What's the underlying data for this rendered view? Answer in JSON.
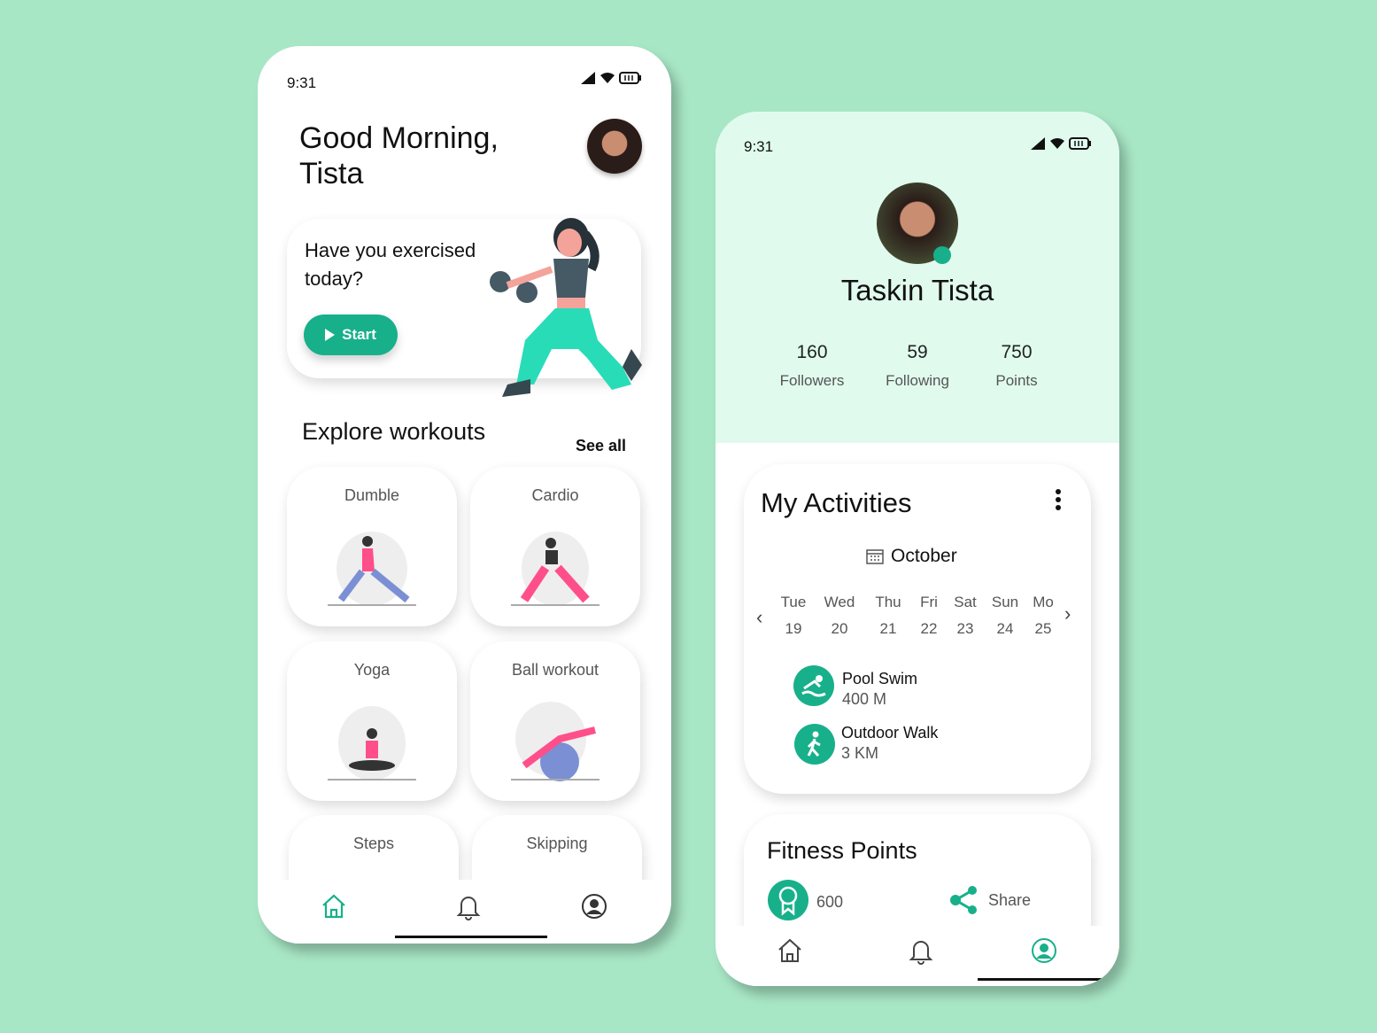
{
  "colors": {
    "background": "#a8e7c6",
    "accent": "#17b08a",
    "profile_header": "#e0fbee"
  },
  "home": {
    "status_time": "9:31",
    "greeting": "Good Morning,",
    "user_name": "Tista",
    "promo": {
      "text_line1": "Have you exercised",
      "text_line2": "today?",
      "start_label": "Start",
      "start_icon": "play-icon"
    },
    "section_title": "Explore workouts",
    "see_all": "See all",
    "workouts": [
      {
        "label": "Dumble"
      },
      {
        "label": "Cardio"
      },
      {
        "label": "Yoga"
      },
      {
        "label": "Ball workout"
      },
      {
        "label": "Steps"
      },
      {
        "label": "Skipping"
      }
    ],
    "nav": {
      "items": [
        "home-icon",
        "bell-icon",
        "profile-icon"
      ],
      "active": "home"
    }
  },
  "profile": {
    "status_time": "9:31",
    "name": "Taskin Tista",
    "stats": [
      {
        "value": "160",
        "label": "Followers"
      },
      {
        "value": "59",
        "label": "Following"
      },
      {
        "value": "750",
        "label": "Points"
      }
    ],
    "activities": {
      "title": "My Activities",
      "month": "October",
      "days": [
        {
          "d": "Tue",
          "n": "19"
        },
        {
          "d": "Wed",
          "n": "20"
        },
        {
          "d": "Thu",
          "n": "21"
        },
        {
          "d": "Fri",
          "n": "22"
        },
        {
          "d": "Sat",
          "n": "23"
        },
        {
          "d": "Sun",
          "n": "24"
        },
        {
          "d": "Mo",
          "n": "25"
        }
      ],
      "items": [
        {
          "name": "Pool Swim",
          "value": "400 M",
          "icon": "swim-icon"
        },
        {
          "name": "Outdoor Walk",
          "value": "3 KM",
          "icon": "walk-icon"
        }
      ]
    },
    "fitness": {
      "title": "Fitness Points",
      "points": "600",
      "share_label": "Share"
    },
    "nav": {
      "items": [
        "home-icon",
        "bell-icon",
        "profile-icon"
      ],
      "active": "profile"
    }
  }
}
